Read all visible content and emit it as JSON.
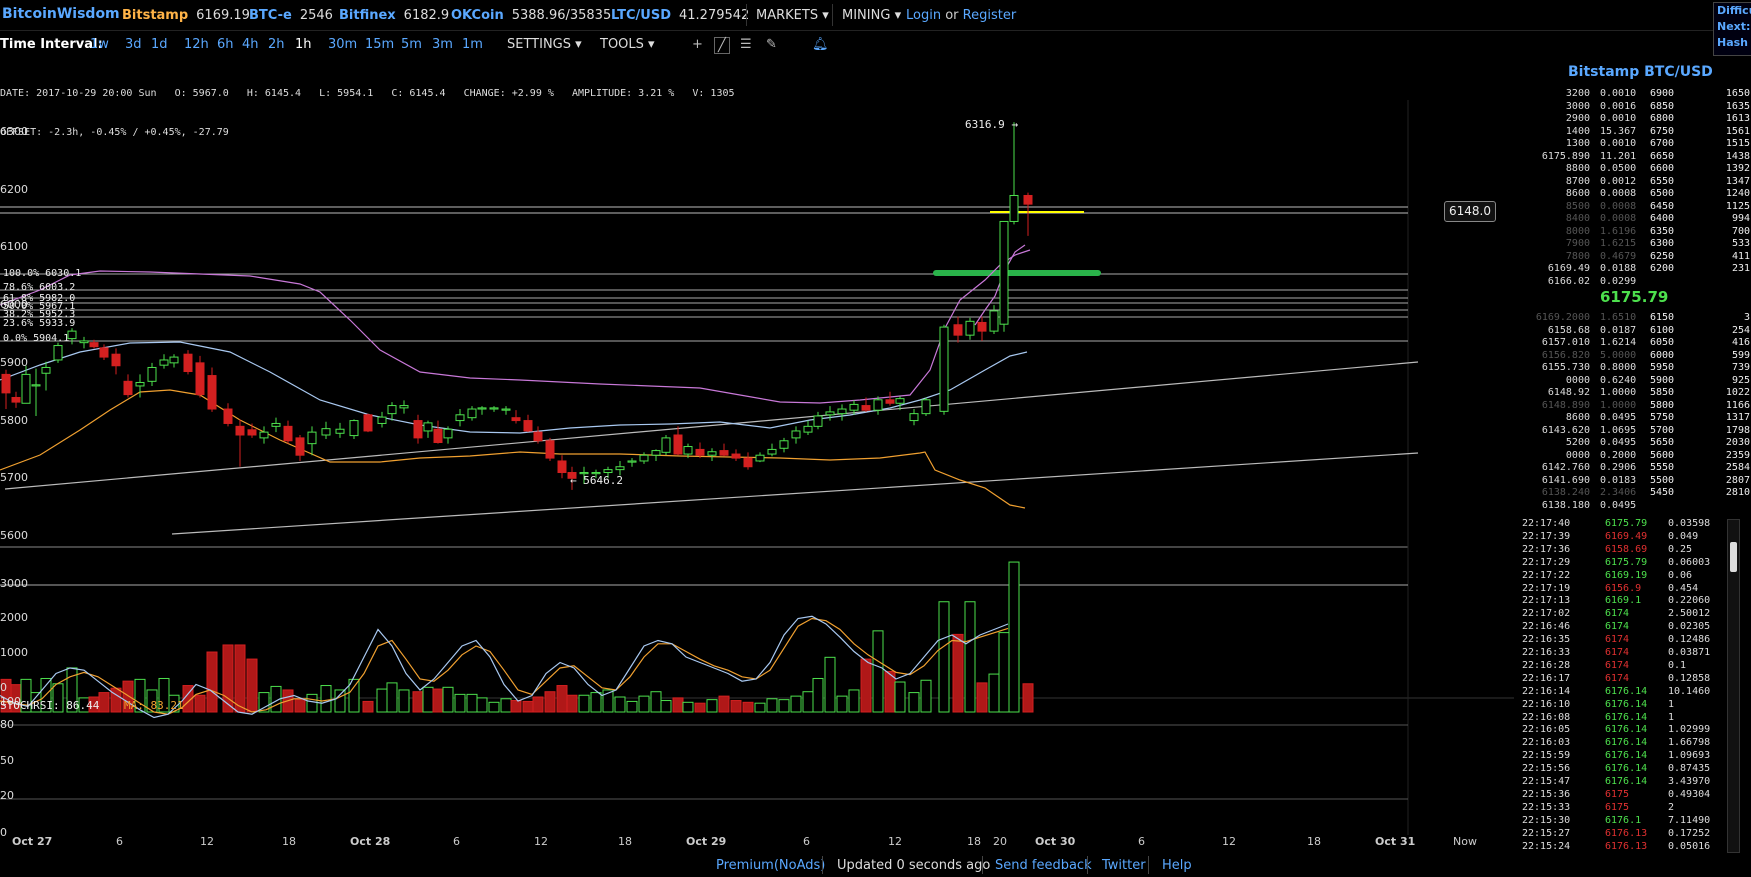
{
  "brand": "BitcoinWisdom",
  "tickers": [
    {
      "exchange": "Bitstamp",
      "price": "6169.19"
    },
    {
      "exchange": "BTC-e",
      "price": "2546"
    },
    {
      "exchange": "Bitfinex",
      "price": "6182.9"
    },
    {
      "exchange": "OKCoin",
      "price": "5388.96/35835"
    },
    {
      "exchange": "LTC/USD",
      "price": "41.279542"
    }
  ],
  "menus": {
    "markets": "MARKETS",
    "mining": "MINING"
  },
  "auth": {
    "login": "Login",
    "or": "or",
    "register": "Register"
  },
  "corner": {
    "line1": "Difficu",
    "line2": "Next:",
    "line3": "Hash R"
  },
  "toolbar": {
    "label": "Time Interval:",
    "intervals": [
      "1w",
      "3d",
      "1d",
      "12h",
      "6h",
      "4h",
      "2h",
      "1h",
      "30m",
      "15m",
      "5m",
      "3m",
      "1m"
    ],
    "selected": "1h",
    "settings": "SETTINGS",
    "tools": "TOOLS"
  },
  "info": {
    "line1": "DATE: 2017-10-29 20:00 Sun   O: 5967.0   H: 6145.4   L: 5954.1   C: 6145.4   CHANGE: +2.99 %   AMPLITUDE: 3.21 %   V: 1305",
    "line2": "OFFSET: -2.3h, -0.45% / +0.45%, -27.79"
  },
  "price_axis": [
    "6300",
    "6200",
    "6100",
    "6000",
    "5900",
    "5800",
    "5700",
    "5600"
  ],
  "volume_axis": [
    "3000",
    "2000",
    "1000",
    "0"
  ],
  "stoch_axis": [
    "100",
    "80",
    "50",
    "20",
    "0"
  ],
  "price_tag": "6148.0",
  "annotations": {
    "high": "6316.9 →",
    "low": "← 5646.2"
  },
  "fib": [
    "100.0% 6030.1",
    "78.6% 6003.2",
    "61.8% 5982.0",
    "50.0% 5967.1",
    "38.2% 5952.3",
    "23.6% 5933.9",
    "0.0% 5904.1"
  ],
  "stoch_label": {
    "k": "STOCHRSI: 86.44",
    "ma": "MA: 83.21"
  },
  "x_axis": [
    {
      "label": "Oct 27",
      "day": true
    },
    {
      "label": "6"
    },
    {
      "label": "12"
    },
    {
      "label": "18"
    },
    {
      "label": "Oct 28",
      "day": true
    },
    {
      "label": "6"
    },
    {
      "label": "12"
    },
    {
      "label": "18"
    },
    {
      "label": "Oct 29",
      "day": true
    },
    {
      "label": "6"
    },
    {
      "label": "12"
    },
    {
      "label": "18"
    },
    {
      "label": "20"
    },
    {
      "label": "Oct 30",
      "day": true
    },
    {
      "label": "6"
    },
    {
      "label": "12"
    },
    {
      "label": "18"
    },
    {
      "label": "Oct 31",
      "day": true
    },
    {
      "label": "Now"
    }
  ],
  "orderbook": {
    "title": "Bitstamp BTC/USD",
    "last": "6175.79",
    "asks": [
      {
        "sum": "3200",
        "amt": "0.0010",
        "price": "6900",
        "cum": "1650"
      },
      {
        "sum": "3000",
        "amt": "0.0016",
        "price": "6850",
        "cum": "1635"
      },
      {
        "sum": "2900",
        "amt": "0.0010",
        "price": "6800",
        "cum": "1613"
      },
      {
        "sum": "1400",
        "amt": "15.367",
        "price": "6750",
        "cum": "1561"
      },
      {
        "sum": "1300",
        "amt": "0.0010",
        "price": "6700",
        "cum": "1515"
      },
      {
        "sum": "6175.890",
        "amt": "11.201",
        "price": "6650",
        "cum": "1438"
      },
      {
        "sum": "8800",
        "amt": "0.0500",
        "price": "6600",
        "cum": "1392"
      },
      {
        "sum": "8700",
        "amt": "0.0012",
        "price": "6550",
        "cum": "1347"
      },
      {
        "sum": "8600",
        "amt": "0.0008",
        "price": "6500",
        "cum": "1240"
      },
      {
        "sum": "8500",
        "amt": "0.0008",
        "price": "6450",
        "cum": "1125"
      },
      {
        "sum": "8400",
        "amt": "0.0008",
        "price": "6400",
        "cum": "994"
      },
      {
        "sum": "8000",
        "amt": "1.6196",
        "price": "6350",
        "cum": "700"
      },
      {
        "sum": "7900",
        "amt": "1.6215",
        "price": "6300",
        "cum": "533"
      },
      {
        "sum": "7800",
        "amt": "0.4679",
        "price": "6250",
        "cum": "411"
      },
      {
        "sum": "6169.49",
        "amt": "0.0188",
        "price": "6200",
        "cum": "231"
      },
      {
        "sum": "6166.02",
        "amt": "0.0299",
        "price": "",
        "cum": ""
      }
    ],
    "bids": [
      {
        "sum": "6169.2000",
        "amt": "1.6510",
        "price": "6150",
        "cum": "3"
      },
      {
        "sum": "6158.68",
        "amt": "0.0187",
        "price": "6100",
        "cum": "254"
      },
      {
        "sum": "6157.010",
        "amt": "1.6214",
        "price": "6050",
        "cum": "416"
      },
      {
        "sum": "6156.820",
        "amt": "5.0000",
        "price": "6000",
        "cum": "599"
      },
      {
        "sum": "6155.730",
        "amt": "0.8000",
        "price": "5950",
        "cum": "739"
      },
      {
        "sum": "0000",
        "amt": "0.6240",
        "price": "5900",
        "cum": "925"
      },
      {
        "sum": "6148.92",
        "amt": "1.0000",
        "price": "5850",
        "cum": "1022"
      },
      {
        "sum": "6148.890",
        "amt": "1.0000",
        "price": "5800",
        "cum": "1166"
      },
      {
        "sum": "8600",
        "amt": "0.0495",
        "price": "5750",
        "cum": "1317"
      },
      {
        "sum": "6143.620",
        "amt": "1.0695",
        "price": "5700",
        "cum": "1798"
      },
      {
        "sum": "5200",
        "amt": "0.0495",
        "price": "5650",
        "cum": "2030"
      },
      {
        "sum": "0000",
        "amt": "0.2000",
        "price": "5600",
        "cum": "2359"
      },
      {
        "sum": "6142.760",
        "amt": "0.2906",
        "price": "5550",
        "cum": "2584"
      },
      {
        "sum": "6141.690",
        "amt": "0.0183",
        "price": "5500",
        "cum": "2807"
      },
      {
        "sum": "6138.240",
        "amt": "2.3406",
        "price": "5450",
        "cum": "2810"
      },
      {
        "sum": "6138.180",
        "amt": "0.0495",
        "price": "",
        "cum": ""
      }
    ]
  },
  "trades": [
    {
      "time": "22:17:40",
      "price": "6175.79",
      "amt": "0.03598",
      "side": "buy"
    },
    {
      "time": "22:17:39",
      "price": "6169.49",
      "amt": "0.049",
      "side": "sell"
    },
    {
      "time": "22:17:36",
      "price": "6158.69",
      "amt": "0.25",
      "side": "sell"
    },
    {
      "time": "22:17:29",
      "price": "6175.79",
      "amt": "0.06003",
      "side": "buy"
    },
    {
      "time": "22:17:22",
      "price": "6169.19",
      "amt": "0.06",
      "side": "buy"
    },
    {
      "time": "22:17:19",
      "price": "6156.9",
      "amt": "0.454",
      "side": "sell"
    },
    {
      "time": "22:17:13",
      "price": "6169.1",
      "amt": "0.22060",
      "side": "buy"
    },
    {
      "time": "22:17:02",
      "price": "6174",
      "amt": "2.50012",
      "side": "buy"
    },
    {
      "time": "22:16:46",
      "price": "6174",
      "amt": "0.02305",
      "side": "buy"
    },
    {
      "time": "22:16:35",
      "price": "6174",
      "amt": "0.12486",
      "side": "sell"
    },
    {
      "time": "22:16:33",
      "price": "6174",
      "amt": "0.03871",
      "side": "sell"
    },
    {
      "time": "22:16:28",
      "price": "6174",
      "amt": "0.1",
      "side": "sell"
    },
    {
      "time": "22:16:17",
      "price": "6174",
      "amt": "0.12858",
      "side": "sell"
    },
    {
      "time": "22:16:14",
      "price": "6176.14",
      "amt": "10.1460",
      "side": "buy"
    },
    {
      "time": "22:16:10",
      "price": "6176.14",
      "amt": "1",
      "side": "buy"
    },
    {
      "time": "22:16:08",
      "price": "6176.14",
      "amt": "1",
      "side": "buy"
    },
    {
      "time": "22:16:05",
      "price": "6176.14",
      "amt": "1.02999",
      "side": "buy"
    },
    {
      "time": "22:16:03",
      "price": "6176.14",
      "amt": "1.66798",
      "side": "buy"
    },
    {
      "time": "22:15:59",
      "price": "6176.14",
      "amt": "1.09693",
      "side": "buy"
    },
    {
      "time": "22:15:56",
      "price": "6176.14",
      "amt": "0.87435",
      "side": "buy"
    },
    {
      "time": "22:15:47",
      "price": "6176.14",
      "amt": "3.43970",
      "side": "buy"
    },
    {
      "time": "22:15:36",
      "price": "6175",
      "amt": "0.49304",
      "side": "sell"
    },
    {
      "time": "22:15:33",
      "price": "6175",
      "amt": "2",
      "side": "sell"
    },
    {
      "time": "22:15:30",
      "price": "6176.1",
      "amt": "7.11490",
      "side": "buy"
    },
    {
      "time": "22:15:27",
      "price": "6176.13",
      "amt": "0.17252",
      "side": "sell"
    },
    {
      "time": "22:15:24",
      "price": "6176.13",
      "amt": "0.05016",
      "side": "sell"
    }
  ],
  "footer": {
    "premium": "Premium(NoAds)",
    "updated": "Updated 0 seconds ago",
    "feedback": "Send feedback",
    "twitter": "Twitter",
    "help": "Help"
  },
  "colors": {
    "accent": "#5aa8ff",
    "up": "#4de04d",
    "down": "#d42020",
    "ma_purple": "#c878d8",
    "ma_orange": "#f0a030",
    "ma_blue": "#a8c8f0"
  }
}
